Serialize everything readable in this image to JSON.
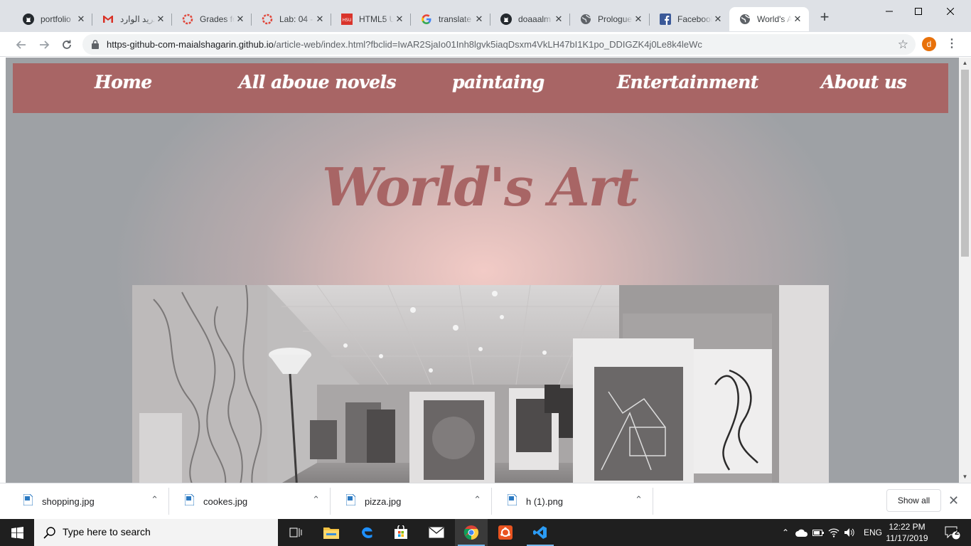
{
  "browser": {
    "tabs": [
      {
        "title": "portfolio",
        "icon": "github-icon",
        "active": false
      },
      {
        "title": "البريد الوارد",
        "icon": "gmail-icon",
        "active": false
      },
      {
        "title": "Grades fo",
        "icon": "circle-red-icon",
        "active": false
      },
      {
        "title": "Lab: 04 -",
        "icon": "circle-red-icon",
        "active": false
      },
      {
        "title": "HTML5 U",
        "icon": "hsu-icon",
        "active": false
      },
      {
        "title": "translate",
        "icon": "google-icon",
        "active": false
      },
      {
        "title": "doaaalm",
        "icon": "github-icon",
        "active": false
      },
      {
        "title": "Prologue",
        "icon": "globe-icon",
        "active": false
      },
      {
        "title": "Facebook",
        "icon": "facebook-icon",
        "active": false
      },
      {
        "title": "World's A",
        "icon": "globe-icon",
        "active": true
      }
    ],
    "url_host": "https-github-com-maialshagarin.github.io",
    "url_path": "/article-web/index.html?fbclid=IwAR2SjaIo01Inh8lgvk5iaqDsxm4VkLH47bI1K1po_DDIGZK4j0Le8k4leWc",
    "profile_initial": "d"
  },
  "page": {
    "nav": [
      "Home",
      "All aboue novels",
      "paintaing",
      "Entertainment",
      "About us"
    ],
    "title": "World's Art",
    "colors": {
      "accent": "#a86565"
    }
  },
  "downloads": {
    "items": [
      "shopping.jpg",
      "cookes.jpg",
      "pizza.jpg",
      "h (1).png"
    ],
    "show_all": "Show all"
  },
  "taskbar": {
    "search_placeholder": "Type here to search",
    "language": "ENG",
    "time": "12:22 PM",
    "date": "11/17/2019",
    "notification_count": "2"
  }
}
